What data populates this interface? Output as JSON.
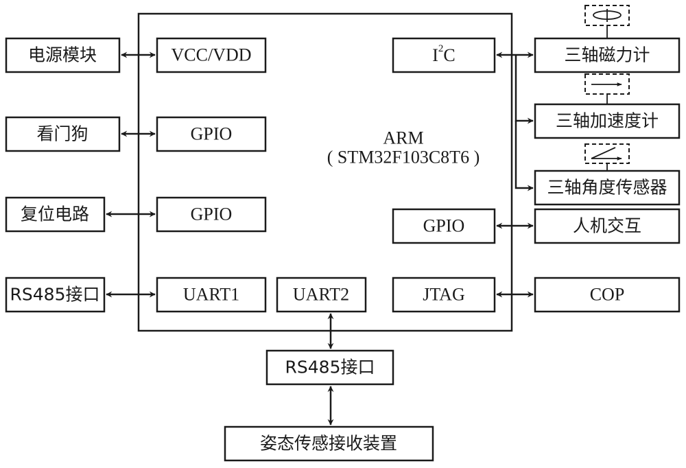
{
  "mcu": {
    "name": "ARM",
    "model": "( STM32F103C8T6 )",
    "ports": {
      "vcc": "VCC/VDD",
      "gpio1": "GPIO",
      "gpio2": "GPIO",
      "uart1": "UART1",
      "uart2": "UART2",
      "i2c_base": "I",
      "i2c_sup": "2",
      "i2c_tail": "C",
      "gpio3": "GPIO",
      "jtag": "JTAG"
    }
  },
  "left_modules": {
    "power": "电源模块",
    "watchdog": "看门狗",
    "reset": "复位电路",
    "rs485": "RS485接口"
  },
  "right_modules": {
    "magnetometer": "三轴磁力计",
    "accelerometer": "三轴加速度计",
    "angle_sensor": "三轴角度传感器",
    "hmi": "人机交互",
    "cop": "COP"
  },
  "bottom_modules": {
    "rs485": "RS485接口",
    "receiver": "姿态传感接收装置"
  },
  "sensor_icons": [
    "rotation-axis-icon",
    "linear-arrow-icon",
    "angle-icon"
  ]
}
